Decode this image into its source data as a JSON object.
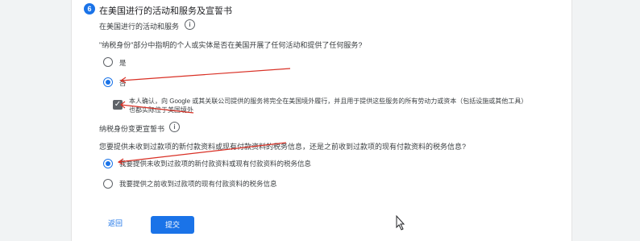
{
  "section": {
    "step_number": "6",
    "title": "在美国进行的活动和服务及宣誓书"
  },
  "us_activities": {
    "subtitle": "在美国进行的活动和服务",
    "question": "\"纳税身份\"部分中指明的个人或实体是否在美国开展了任何活动和提供了任何服务?",
    "options": [
      {
        "label": "是",
        "selected": false
      },
      {
        "label": "否",
        "selected": true
      }
    ],
    "confirm_line1": "本人确认，向 Google 或其关联公司提供的服务将完全在美国境外履行，并且用于提供这些服务的所有劳动力或资本（包括设施或其他工具）",
    "confirm_line2": "也都实际位于美国境外",
    "confirm_checked": true
  },
  "tax_change": {
    "subtitle": "纳税身份变更宣誓书",
    "question": "您要提供未收到过款项的新付款资料或现有付款资料的税务信息，还是之前收到过款项的现有付款资料的税务信息?",
    "options": [
      {
        "label": "我要提供未收到过款项的新付款资料或现有付款资料的税务信息",
        "selected": true
      },
      {
        "label": "我要提供之前收到过款项的现有付款资料的税务信息",
        "selected": false
      }
    ]
  },
  "actions": {
    "back_label": "返回",
    "submit_label": "提交"
  },
  "icons": {
    "info": "info-icon",
    "check": "check-icon",
    "cursor": "mouse-cursor-icon"
  },
  "colors": {
    "accent": "#1a73e8",
    "annotation": "#d93025"
  }
}
